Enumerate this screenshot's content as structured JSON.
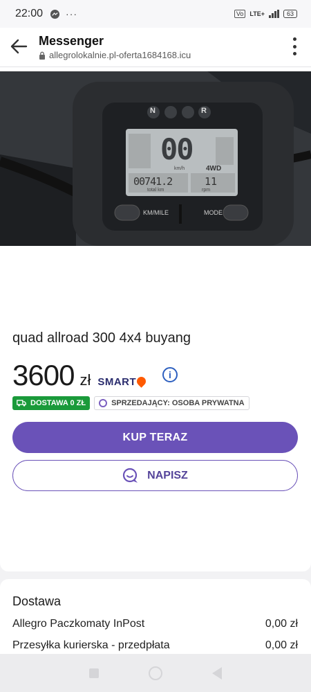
{
  "status_bar": {
    "time": "22:00",
    "dots": "···",
    "volte": "Vo",
    "network": "LTE+",
    "battery": "63"
  },
  "header": {
    "title": "Messenger",
    "url": "allegrolokalnie.pl-oferta1684168.icu"
  },
  "listing": {
    "title": "quad allroad 300 4x4 buyang",
    "price": "3600",
    "currency": "zł",
    "smart_label": "SMART",
    "delivery_badge": "DOSTAWA 0 ZŁ",
    "seller_badge": "SPRZEDAJĄCY: OSOBA PRYWATNA",
    "buy_button": "KUP TERAZ",
    "message_button": "NAPISZ"
  },
  "photo": {
    "indicators": [
      "N",
      "",
      "",
      "R"
    ],
    "odometer": "00741.2",
    "speed": "00",
    "drive_mode": "4WD",
    "rpm_value": "11",
    "labels": {
      "speed_unit": "km/h",
      "total_km": "total km",
      "rpm": "rpm",
      "left_button": "KM/MILE",
      "right_button": "MODE"
    }
  },
  "shipping": {
    "title": "Dostawa",
    "options": [
      {
        "name": "Allegro Paczkomaty InPost",
        "price": "0,00 zł"
      },
      {
        "name": "Przesyłka kurierska - przedpłata",
        "price": "0,00 zł"
      }
    ]
  },
  "colors": {
    "primary": "#6a52b8",
    "green_badge": "#1a9a3a",
    "smart_orange": "#ff5a00",
    "info_blue": "#2d5fbf"
  }
}
